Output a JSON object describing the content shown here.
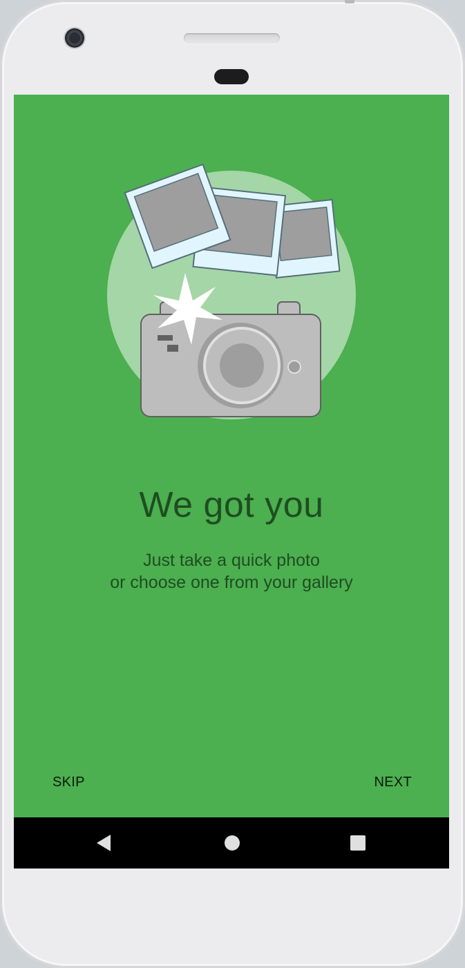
{
  "onboarding": {
    "title": "We got you",
    "subtitle_line1": "Just take a quick photo",
    "subtitle_line2": "or choose one from your gallery",
    "skip_label": "SKIP",
    "next_label": "NEXT"
  },
  "colors": {
    "background": "#4caf50",
    "text": "#1f4d21",
    "nav_bar": "#000000"
  },
  "nav_bar": {
    "icons": [
      "back-icon",
      "home-icon",
      "recents-icon"
    ]
  }
}
